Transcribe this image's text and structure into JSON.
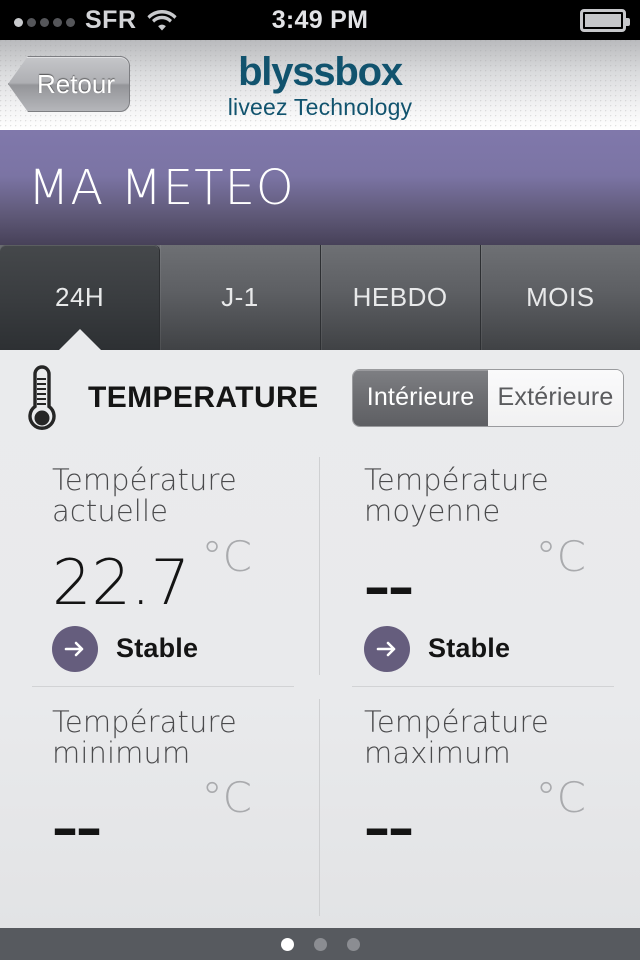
{
  "status_bar": {
    "carrier": "SFR",
    "time": "3:49 PM",
    "signal_bars_filled": 1,
    "signal_bars_total": 5,
    "wifi_icon": "wifi-icon",
    "battery_icon": "battery-icon",
    "battery_level_percent": 90
  },
  "brand_bar": {
    "back_label": "Retour",
    "logo_name": "blyssbox",
    "logo_tagline": "liveez Technology",
    "logo_color": "#11536e"
  },
  "header": {
    "title": "MA METEO",
    "accent_color": "#7b74a4"
  },
  "tabs": [
    {
      "label": "24H",
      "active": true
    },
    {
      "label": "J-1",
      "active": false
    },
    {
      "label": "HEBDO",
      "active": false
    },
    {
      "label": "MOIS",
      "active": false
    }
  ],
  "section": {
    "icon": "thermometer-icon",
    "title": "TEMPERATURE",
    "toggle": {
      "options": [
        {
          "label": "Intérieure",
          "selected": true
        },
        {
          "label": "Extérieure",
          "selected": false
        }
      ]
    }
  },
  "stats": [
    {
      "label_line1": "Température",
      "label_line2": "actuelle",
      "value": "22.7",
      "unit": "°C",
      "trend_icon": "arrow-right-icon",
      "trend_label": "Stable",
      "trend_color": "#655d7d"
    },
    {
      "label_line1": "Température",
      "label_line2": "moyenne",
      "value": "––",
      "unit": "°C",
      "trend_icon": "arrow-right-icon",
      "trend_label": "Stable",
      "trend_color": "#655d7d"
    },
    {
      "label_line1": "Température",
      "label_line2": "minimum",
      "value": "––",
      "unit": "°C",
      "trend_icon": null,
      "trend_label": null
    },
    {
      "label_line1": "Température",
      "label_line2": "maximum",
      "value": "––",
      "unit": "°C",
      "trend_icon": null,
      "trend_label": null
    }
  ],
  "pagination": {
    "total": 3,
    "current": 1
  }
}
